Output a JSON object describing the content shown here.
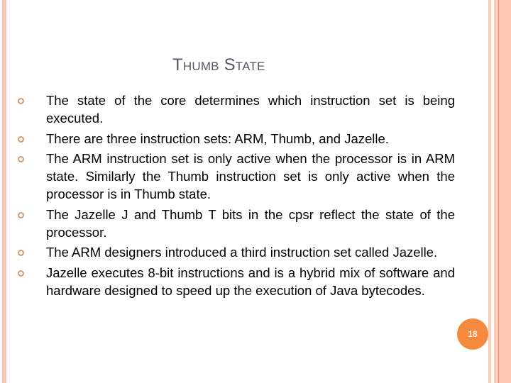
{
  "slide": {
    "title": "Thumb State",
    "bullets": [
      {
        "text": "The state of the core determines which instruction set is being executed."
      },
      {
        "text": "There are three instruction sets: ARM, Thumb, and Jazelle."
      },
      {
        "text": "The ARM instruction set is only active when the processor is in ARM state. Similarly the Thumb instruction set is only active when the processor is in Thumb state."
      },
      {
        "text": "The Jazelle J and Thumb T bits in the cpsr reflect the state of the processor."
      },
      {
        "text": "The ARM designers introduced a third instruction set called Jazelle."
      },
      {
        "text": "Jazelle executes 8-bit instructions and is a hybrid mix of software and hardware designed to speed up the execution of Java bytecodes."
      }
    ],
    "bullet_icon": "hollow-circle-bullet",
    "page_number": "18"
  },
  "colors": {
    "title": "#545860",
    "text": "#000000",
    "bullet": "#d49a6a",
    "page_badge": "#f58a3f",
    "border_peach": "#fcc9b5",
    "border_line": "#e8946c"
  }
}
